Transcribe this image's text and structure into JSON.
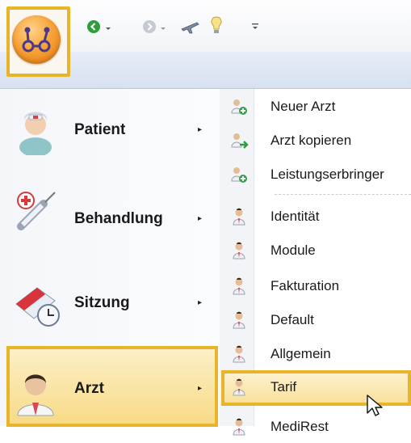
{
  "toolbar": {
    "items": [
      {
        "name": "back-icon",
        "color": "#2e9e3a"
      },
      {
        "name": "forward-icon",
        "color": "#b9bdc6"
      },
      {
        "name": "airplane-icon"
      },
      {
        "name": "lightbulb-icon"
      },
      {
        "name": "customize-toolbar-icon"
      }
    ]
  },
  "app_button": {
    "name": "app-menu-icon",
    "color": "#f39a2c"
  },
  "menu": {
    "items": [
      {
        "label": "Patient",
        "icon": "patient-icon"
      },
      {
        "label": "Behandlung",
        "icon": "syringe-icon"
      },
      {
        "label": "Sitzung",
        "icon": "calendar-clock-icon"
      },
      {
        "label": "Arzt",
        "icon": "doctor-icon",
        "active": true
      }
    ],
    "arrow": "▸",
    "submenu": [
      {
        "label": "Neuer Arzt",
        "icon": "add-doctor-icon"
      },
      {
        "label": "Arzt kopieren",
        "icon": "copy-doctor-icon"
      },
      {
        "label": "Leistungserbringer",
        "icon": "add-provider-icon"
      },
      {
        "label": "Identität",
        "icon": "doctor-small-icon"
      },
      {
        "label": "Module",
        "icon": "doctor-small-icon"
      },
      {
        "label": "Fakturation",
        "icon": "doctor-small-icon"
      },
      {
        "label": "Default",
        "icon": "doctor-small-icon"
      },
      {
        "label": "Allgemein",
        "icon": "doctor-small-icon"
      },
      {
        "label": "Tarif",
        "icon": "doctor-small-icon",
        "highlighted": true
      },
      {
        "label": "MediRest",
        "icon": "doctor-small-icon"
      }
    ]
  },
  "colors": {
    "highlight_border": "#e8b52a",
    "highlight_fill": "#f9e19b"
  }
}
